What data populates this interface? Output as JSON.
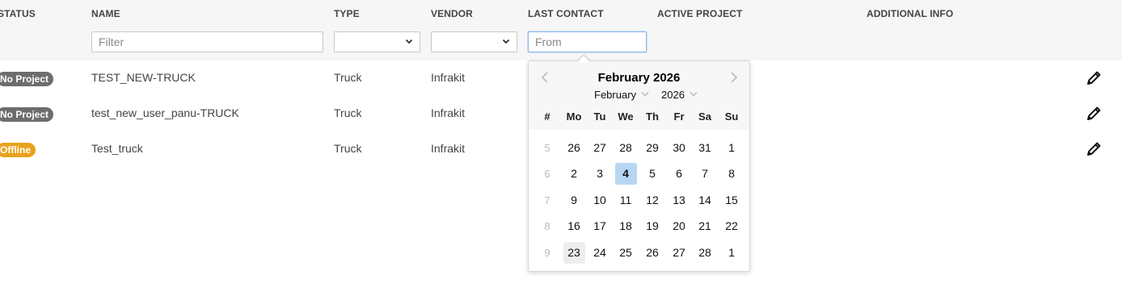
{
  "table": {
    "headers": {
      "status": "STATUS",
      "name": "NAME",
      "type": "TYPE",
      "vendor": "VENDOR",
      "last_contact": "LAST CONTACT",
      "active_project": "ACTIVE PROJECT",
      "additional_info": "ADDITIONAL INFO"
    },
    "filters": {
      "name_placeholder": "Filter",
      "type_value": "",
      "vendor_value": "",
      "last_contact_placeholder": "From"
    },
    "rows": [
      {
        "status": "No Project",
        "status_color": "#6d6d6d",
        "name": "TEST_NEW-TRUCK",
        "type": "Truck",
        "vendor": "Infrakit"
      },
      {
        "status": "No Project",
        "status_color": "#6d6d6d",
        "name": "test_new_user_panu-TRUCK",
        "type": "Truck",
        "vendor": "Infrakit"
      },
      {
        "status": "Offline",
        "status_color": "#e8a21c",
        "name": "Test_truck",
        "type": "Truck",
        "vendor": "Infrakit"
      }
    ],
    "row_action_icon": "pencil-icon"
  },
  "datepicker": {
    "title": "February 2026",
    "month_select": "February",
    "year_select": "2026",
    "prev_icon": "chevron-left-icon",
    "next_icon": "chevron-right-icon",
    "headers": [
      "#",
      "Mo",
      "Tu",
      "We",
      "Th",
      "Fr",
      "Sa",
      "Su"
    ],
    "weeks": [
      {
        "week": "5",
        "days": [
          "26",
          "27",
          "28",
          "29",
          "30",
          "31",
          "1"
        ]
      },
      {
        "week": "6",
        "days": [
          "2",
          "3",
          "4",
          "5",
          "6",
          "7",
          "8"
        ]
      },
      {
        "week": "7",
        "days": [
          "9",
          "10",
          "11",
          "12",
          "13",
          "14",
          "15"
        ]
      },
      {
        "week": "8",
        "days": [
          "16",
          "17",
          "18",
          "19",
          "20",
          "21",
          "22"
        ]
      },
      {
        "week": "9",
        "days": [
          "23",
          "24",
          "25",
          "26",
          "27",
          "28",
          "1"
        ]
      }
    ],
    "today": "4",
    "hovered": "23",
    "colors": {
      "today_bg": "#b7d6f2",
      "hover_bg": "#ededed"
    }
  }
}
